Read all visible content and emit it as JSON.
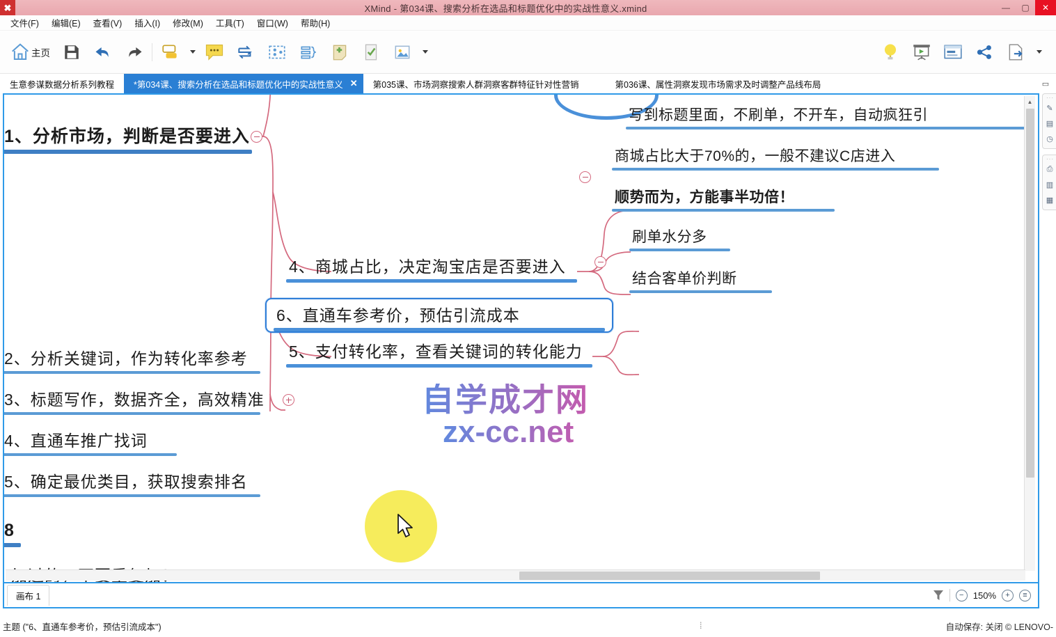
{
  "window": {
    "title": "XMind - 第034课、搜索分析在选品和标题优化中的实战性意义.xmind",
    "app_icon": "xmind-logo-icon",
    "minimize": "—",
    "maximize": "▢",
    "close": "✕"
  },
  "menubar": {
    "items": [
      {
        "label": "文件(F)",
        "name": "menu-file"
      },
      {
        "label": "编辑(E)",
        "name": "menu-edit"
      },
      {
        "label": "查看(V)",
        "name": "menu-view"
      },
      {
        "label": "插入(I)",
        "name": "menu-insert"
      },
      {
        "label": "修改(M)",
        "name": "menu-modify"
      },
      {
        "label": "工具(T)",
        "name": "menu-tools"
      },
      {
        "label": "窗口(W)",
        "name": "menu-window"
      },
      {
        "label": "帮助(H)",
        "name": "menu-help"
      }
    ]
  },
  "toolbar": {
    "home_label": "主页",
    "left_icons": [
      "home-icon",
      "save-icon",
      "undo-icon",
      "redo-icon",
      "topic-icon",
      "topic-dropdown-caret",
      "comment-icon",
      "relationship-icon",
      "boundary-icon",
      "summary-icon",
      "note-icon",
      "checklist-icon",
      "image-icon",
      "image-dropdown-caret"
    ],
    "right_icons": [
      "brainstorm-bulb-icon",
      "presentation-icon",
      "outline-view-icon",
      "share-icon",
      "export-icon",
      "export-dropdown-caret"
    ]
  },
  "tabs": {
    "items": [
      {
        "label": "生意参谋数据分析系列教程",
        "active": false,
        "closable": false
      },
      {
        "label": "*第034课、搜索分析在选品和标题优化中的实战性意义",
        "active": true,
        "closable": true,
        "close_glyph": "✕"
      },
      {
        "label": "第035课、市场洞察搜索人群洞察客群特征针对性营销",
        "active": false,
        "closable": false
      },
      {
        "label": "第036课、属性洞察发现市场需求及时调整产品线布局",
        "active": false,
        "closable": false
      }
    ],
    "restore_glyph": "▭"
  },
  "mindmap": {
    "nodes": [
      {
        "id": "n1",
        "text": "1、分析市场，判断是否要进入",
        "level": 1,
        "collapse": "minus"
      },
      {
        "id": "n4",
        "text": "4、商城占比，决定淘宝店是否要进入",
        "level": 2,
        "collapse": "minus"
      },
      {
        "id": "n5",
        "text": "5、支付转化率，查看关键词的转化能力",
        "level": 2,
        "collapse": "minus"
      },
      {
        "id": "n6",
        "text": "6、直通车参考价，预估引流成本",
        "level": 2,
        "selected": true
      },
      {
        "id": "r1",
        "text": "写到标题里面，不刷单，不开车，自动疯狂引",
        "level": 3
      },
      {
        "id": "r2",
        "text": "商城占比大于70%的，一般不建议C店进入",
        "level": 3
      },
      {
        "id": "r3",
        "text": "顺势而为，方能事半功倍！",
        "level": 3,
        "bold": true
      },
      {
        "id": "r4",
        "text": "刷单水分多",
        "level": 3
      },
      {
        "id": "r5",
        "text": "结合客单价判断",
        "level": 3
      },
      {
        "id": "n2",
        "text": "2、分析关键词，作为转化率参考",
        "level": 2
      },
      {
        "id": "n3",
        "text": "3、标题写作，数据齐全，高效精准",
        "level": 2,
        "collapse": "plus"
      },
      {
        "id": "n4b",
        "text": "4、直通车推广找词",
        "level": 2
      },
      {
        "id": "n5b",
        "text": "5、确定最优类目，获取搜索排名",
        "level": 2
      },
      {
        "id": "n8",
        "text": "8",
        "level": 1
      },
      {
        "id": "n9",
        "text": "加过的，不要重复加！",
        "level": 2
      }
    ],
    "colors": {
      "branch_line": "#d4697e",
      "node_underline": "#4a90d9",
      "selection_border": "#2f7ed8",
      "collapse_circle": "#d46a7f"
    }
  },
  "watermark": {
    "line1": "自学成才网",
    "line2": "zx-cc.net"
  },
  "cursor": {
    "highlight_color": "#f5ea4e",
    "icon": "mouse-pointer-icon"
  },
  "right_panel": {
    "groups": [
      {
        "icons": [
          "style-icon",
          "swatch-icon",
          "clock-icon"
        ]
      },
      {
        "icons": [
          "printer-icon",
          "layout-icon",
          "gallery-icon"
        ]
      }
    ]
  },
  "sheetbar": {
    "sheet_label": "画布 1",
    "filter_icon": "funnel-icon",
    "zoom_out": "−",
    "zoom_value": "150%",
    "zoom_in": "+",
    "zoom_menu": "≡"
  },
  "statusbar": {
    "left": "主题 (\"6、直通车参考价，预估引流成本\")",
    "middle": "⁞",
    "right": "自动保存: 关闭  © LENOVO-"
  }
}
